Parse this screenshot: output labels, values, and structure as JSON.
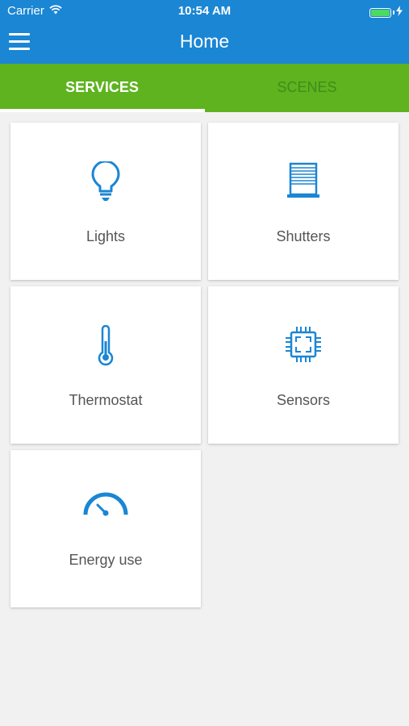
{
  "status_bar": {
    "carrier": "Carrier",
    "time": "10:54 AM",
    "battery_level": 1.0
  },
  "nav": {
    "title": "Home",
    "menu_icon": "hamburger-menu-icon"
  },
  "tabs": [
    {
      "label": "SERVICES",
      "active": true
    },
    {
      "label": "SCENES",
      "active": false
    }
  ],
  "services": [
    {
      "label": "Lights",
      "icon": "lightbulb-icon"
    },
    {
      "label": "Shutters",
      "icon": "shutter-icon"
    },
    {
      "label": "Thermostat",
      "icon": "thermometer-icon"
    },
    {
      "label": "Sensors",
      "icon": "chip-sensor-icon"
    },
    {
      "label": "Energy use",
      "icon": "gauge-icon"
    }
  ],
  "colors": {
    "header_blue": "#1a86d4",
    "tab_green": "#5eb31f",
    "icon_blue": "#1a86d4",
    "background": "#f1f1f1"
  }
}
